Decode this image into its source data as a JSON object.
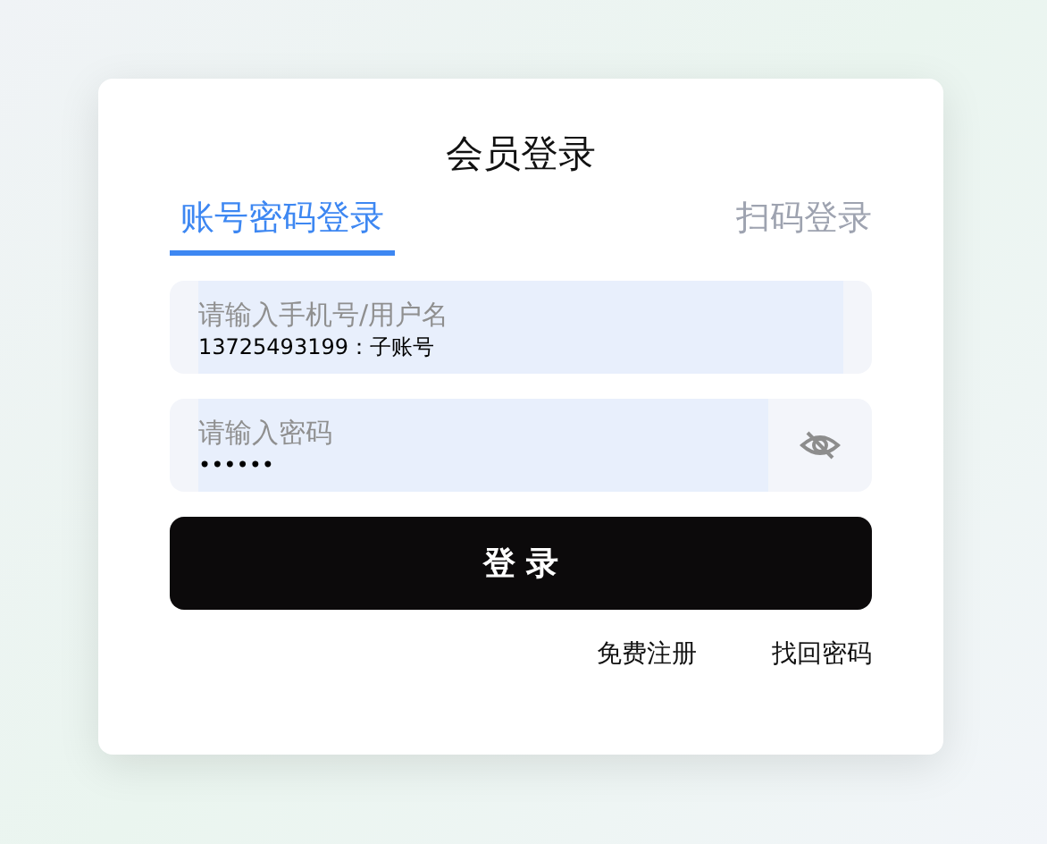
{
  "title": "会员登录",
  "tabs": [
    {
      "label": "账号密码登录",
      "selected": true
    },
    {
      "label": "扫码登录",
      "selected": false
    }
  ],
  "fields": [
    {
      "kind": "text",
      "placeholder": "请输入手机号/用户名",
      "autofill_preview": "13725493199：子账号"
    },
    {
      "kind": "password",
      "placeholder": "请输入密码",
      "autofill_preview": "••••••"
    }
  ],
  "login_button": "登 录",
  "links": [
    "免费注册",
    "找回密码"
  ]
}
